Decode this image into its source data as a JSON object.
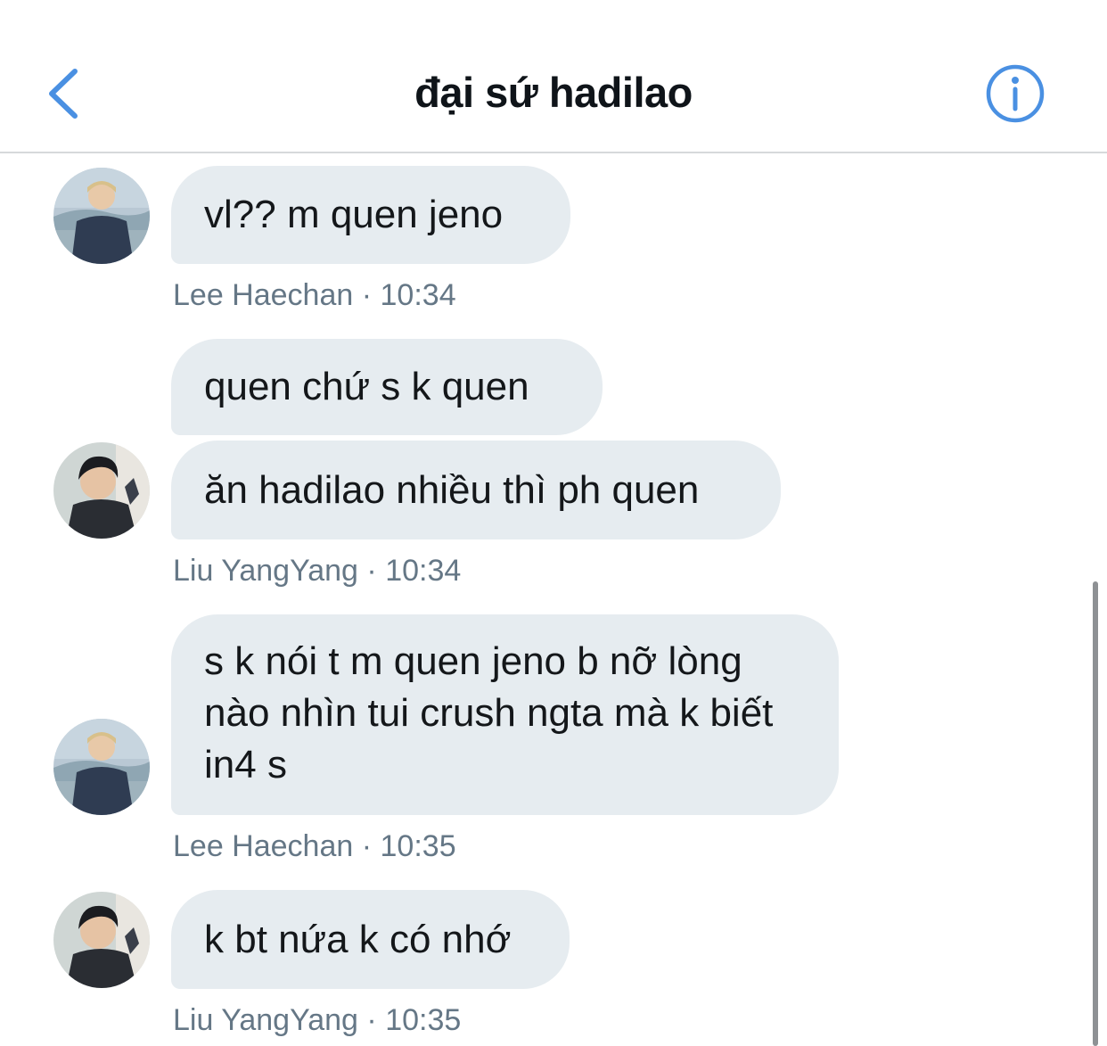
{
  "header": {
    "title": "đại sứ hadilao",
    "back_icon": "chevron-left-icon",
    "info_icon": "info-icon",
    "accent_color": "#4a90e2"
  },
  "messages": [
    {
      "sender": "Lee Haechan",
      "time": "10:34",
      "bubbles": [
        "vl?? m quen jeno"
      ]
    },
    {
      "sender": "Liu YangYang",
      "time": "10:34",
      "bubbles": [
        "quen chứ s k quen",
        "ăn hadilao nhiều thì ph quen"
      ]
    },
    {
      "sender": "Lee Haechan",
      "time": "10:35",
      "bubbles": [
        "s k nói t m quen jeno b nỡ lòng nào nhìn tui crush ngta mà k biết in4 s"
      ]
    },
    {
      "sender": "Liu YangYang",
      "time": "10:35",
      "bubbles": [
        "k bt nứa k có nhớ"
      ]
    }
  ],
  "meta_separator": "·",
  "colors": {
    "bubble_bg": "#e6ecf0",
    "meta_text": "#657786"
  }
}
